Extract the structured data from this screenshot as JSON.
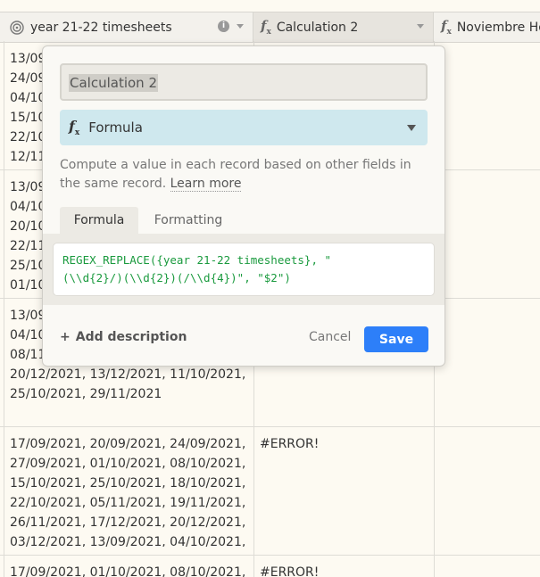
{
  "columns": {
    "col1": {
      "label": "year 21-22 timesheets",
      "icon": "lookup-icon"
    },
    "col2": {
      "label": "Calculation 2",
      "icon": "formula-icon"
    },
    "col3": {
      "label": "Noviembre Ho",
      "icon": "formula-icon"
    }
  },
  "rows": [
    {
      "col1_lines": [
        "13/09",
        "24/09",
        "04/10",
        "15/10",
        "22/10",
        "12/11"
      ],
      "col2": ""
    },
    {
      "col1_lines": [
        "13/09",
        "04/10",
        "20/10",
        "22/11",
        "25/10",
        "01/10"
      ],
      "col2": ""
    },
    {
      "col1_lines": [
        "13/09",
        "04/10",
        "08/11",
        "20/12/2021, 13/12/2021, 11/10/2021,",
        "25/10/2021, 29/11/2021"
      ],
      "col2": ""
    },
    {
      "col1_lines": [
        "17/09/2021, 20/09/2021, 24/09/2021,",
        "27/09/2021, 01/10/2021, 08/10/2021,",
        "15/10/2021, 25/10/2021, 18/10/2021,",
        "22/10/2021, 05/11/2021, 19/11/2021,",
        "26/11/2021, 17/12/2021, 20/12/2021,",
        "03/12/2021, 13/09/2021, 04/10/2021, ..."
      ],
      "col2": "#ERROR!"
    },
    {
      "col1_lines": [
        "17/09/2021, 01/10/2021, 08/10/2021,"
      ],
      "col2": "#ERROR!"
    }
  ],
  "popup": {
    "field_name": "Calculation 2",
    "field_type": "Formula",
    "description": "Compute a value in each record based on other fields in the same record.",
    "learn_more": "Learn more",
    "tabs": [
      {
        "label": "Formula",
        "active": true
      },
      {
        "label": "Formatting",
        "active": false
      }
    ],
    "formula_line1": "REGEX_REPLACE({year 21-22 timesheets}, \"",
    "formula_line2": "(\\\\d{2}/)(\\\\d{2})(/\\\\d{4})\", \"$2\")",
    "add_description": "Add description",
    "cancel_label": "Cancel",
    "save_label": "Save"
  },
  "colors": {
    "accent": "#2d7ff9",
    "type_bg": "#cfe8ee",
    "formula_text": "#1a9a3e",
    "background": "#fdfaf2"
  }
}
